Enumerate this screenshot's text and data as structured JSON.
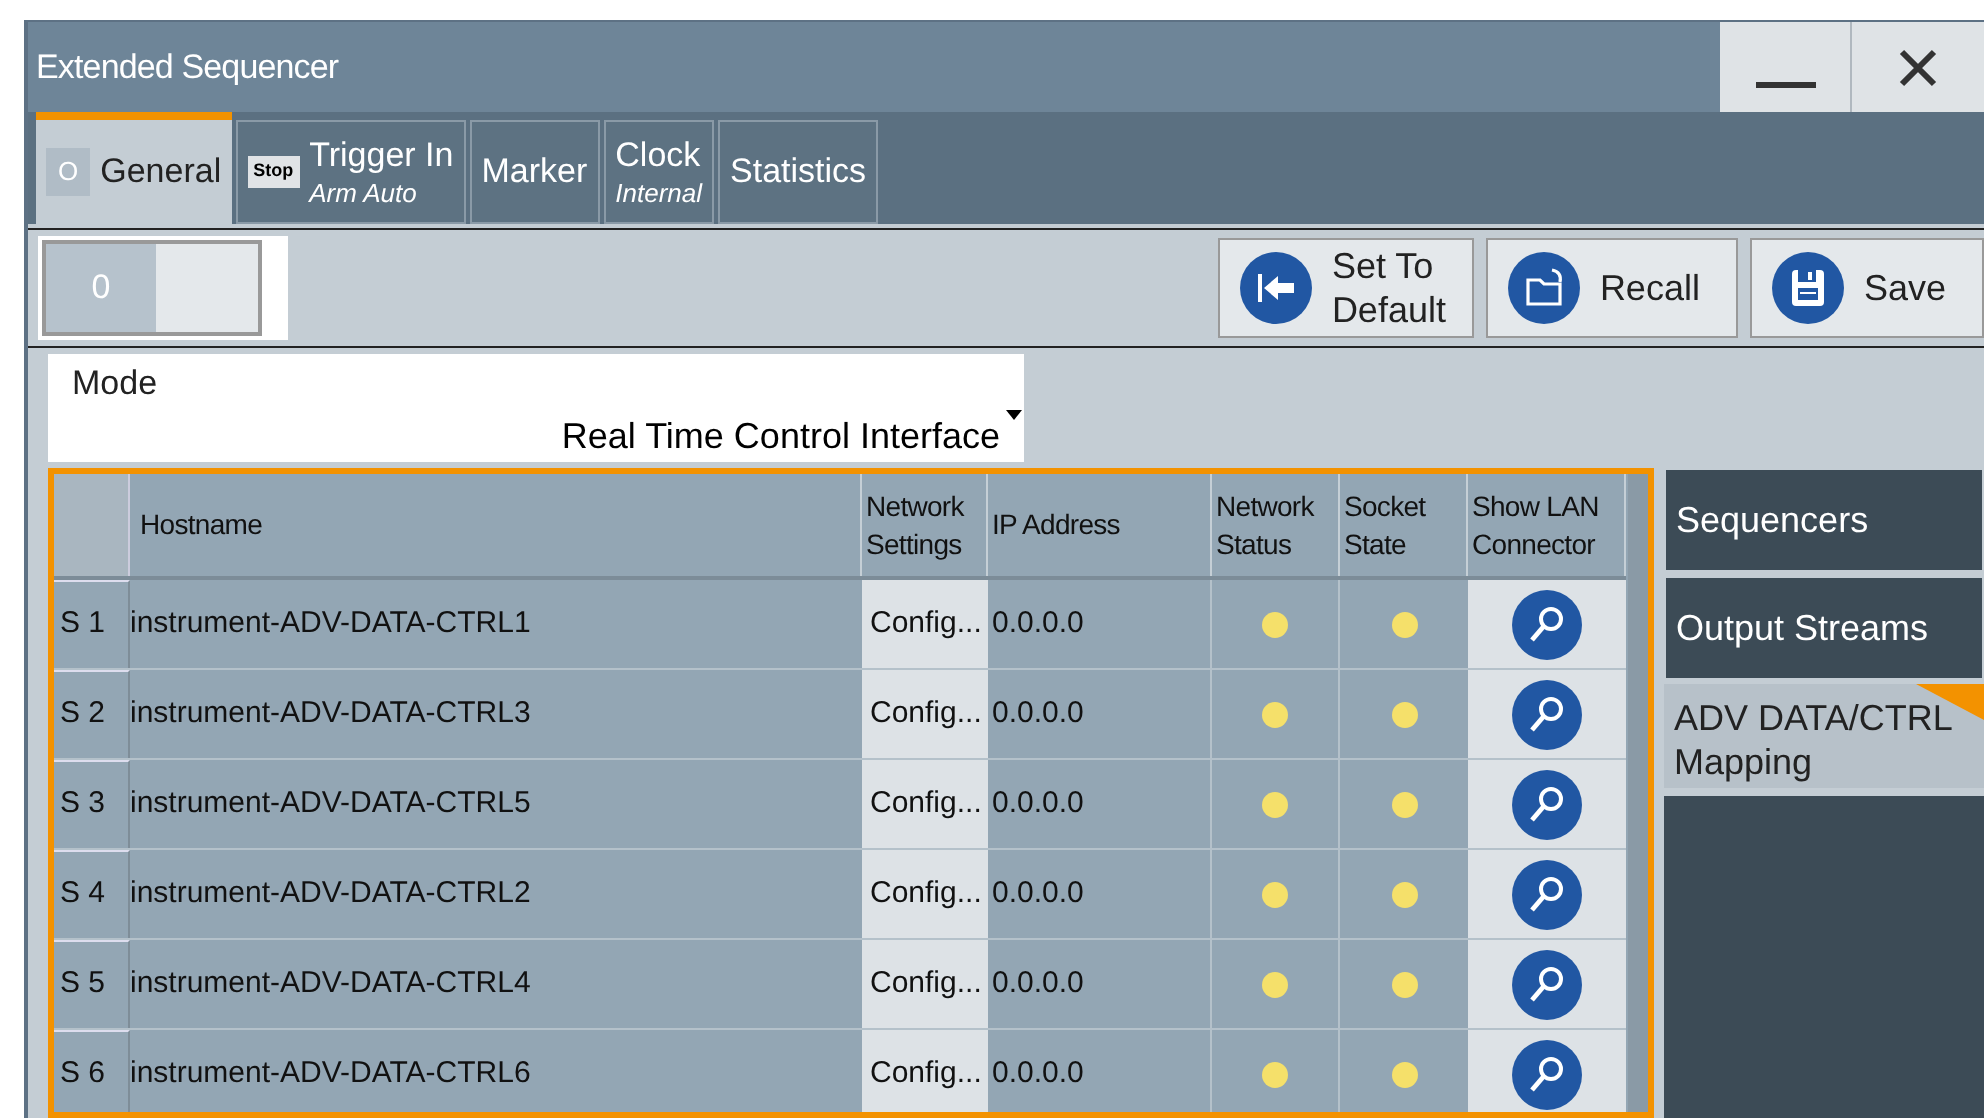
{
  "window": {
    "title": "Extended Sequencer"
  },
  "tabs": [
    {
      "label": "General",
      "indicator": "O",
      "selected": true
    },
    {
      "label": "Trigger In",
      "badge": "Stop",
      "subtitle": "Arm Auto",
      "selected": false
    },
    {
      "label": "Marker",
      "selected": false
    },
    {
      "label": "Clock",
      "subtitle": "Internal",
      "selected": false
    },
    {
      "label": "Statistics",
      "selected": false
    }
  ],
  "toggle": {
    "value": "0",
    "on": false
  },
  "toolbar": [
    {
      "label": "Set To Default",
      "kind": "default"
    },
    {
      "label": "Recall",
      "kind": "recall"
    },
    {
      "label": "Save",
      "kind": "save"
    }
  ],
  "mode": {
    "label": "Mode",
    "value": "Real Time Control Interface"
  },
  "table": {
    "columns": [
      "Hostname",
      "Network Settings",
      "IP Address",
      "Network Status",
      "Socket State",
      "Show LAN Connector"
    ],
    "rows": [
      {
        "index": "S 1",
        "hostname": "instrument-ADV-DATA-CTRL1",
        "settings": "Config...",
        "ip": "0.0.0.0",
        "network_status": {
          "color": "#f5e06a"
        },
        "socket_state": {
          "color": "#f5e06a"
        }
      },
      {
        "index": "S 2",
        "hostname": "instrument-ADV-DATA-CTRL3",
        "settings": "Config...",
        "ip": "0.0.0.0",
        "network_status": {
          "color": "#f5e06a"
        },
        "socket_state": {
          "color": "#f5e06a"
        }
      },
      {
        "index": "S 3",
        "hostname": "instrument-ADV-DATA-CTRL5",
        "settings": "Config...",
        "ip": "0.0.0.0",
        "network_status": {
          "color": "#f5e06a"
        },
        "socket_state": {
          "color": "#f5e06a"
        }
      },
      {
        "index": "S 4",
        "hostname": "instrument-ADV-DATA-CTRL2",
        "settings": "Config...",
        "ip": "0.0.0.0",
        "network_status": {
          "color": "#f5e06a"
        },
        "socket_state": {
          "color": "#f5e06a"
        }
      },
      {
        "index": "S 5",
        "hostname": "instrument-ADV-DATA-CTRL4",
        "settings": "Config...",
        "ip": "0.0.0.0",
        "network_status": {
          "color": "#f5e06a"
        },
        "socket_state": {
          "color": "#f5e06a"
        }
      },
      {
        "index": "S 6",
        "hostname": "instrument-ADV-DATA-CTRL6",
        "settings": "Config...",
        "ip": "0.0.0.0",
        "network_status": {
          "color": "#f5e06a"
        },
        "socket_state": {
          "color": "#f5e06a"
        }
      }
    ]
  },
  "side_nav": [
    {
      "label": "Sequencers",
      "selected": false
    },
    {
      "label": "Output Streams",
      "selected": false
    },
    {
      "label": "ADV DATA/CTRL Mapping",
      "selected": true
    }
  ]
}
